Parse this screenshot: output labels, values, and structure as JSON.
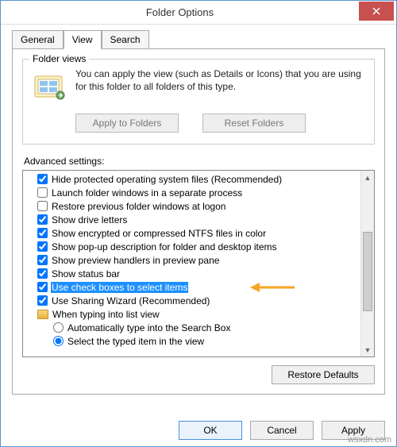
{
  "window": {
    "title": "Folder Options"
  },
  "tabs": {
    "general": "General",
    "view": "View",
    "search": "Search"
  },
  "folderViews": {
    "legend": "Folder views",
    "text": "You can apply the view (such as Details or Icons) that you are using for this folder to all folders of this type.",
    "applyBtn": "Apply to Folders",
    "resetBtn": "Reset Folders"
  },
  "advancedLabel": "Advanced settings:",
  "items": [
    {
      "type": "checkbox",
      "checked": true,
      "label": "Hide protected operating system files (Recommended)"
    },
    {
      "type": "checkbox",
      "checked": false,
      "label": "Launch folder windows in a separate process"
    },
    {
      "type": "checkbox",
      "checked": false,
      "label": "Restore previous folder windows at logon"
    },
    {
      "type": "checkbox",
      "checked": true,
      "label": "Show drive letters"
    },
    {
      "type": "checkbox",
      "checked": true,
      "label": "Show encrypted or compressed NTFS files in color"
    },
    {
      "type": "checkbox",
      "checked": true,
      "label": "Show pop-up description for folder and desktop items"
    },
    {
      "type": "checkbox",
      "checked": true,
      "label": "Show preview handlers in preview pane"
    },
    {
      "type": "checkbox",
      "checked": true,
      "label": "Show status bar"
    },
    {
      "type": "checkbox",
      "checked": true,
      "label": "Use check boxes to select items",
      "highlighted": true
    },
    {
      "type": "checkbox",
      "checked": true,
      "label": "Use Sharing Wizard (Recommended)"
    },
    {
      "type": "folder",
      "label": "When typing into list view"
    },
    {
      "type": "radio",
      "checked": false,
      "label": "Automatically type into the Search Box",
      "sub": true
    },
    {
      "type": "radio",
      "checked": true,
      "label": "Select the typed item in the view",
      "sub": true
    }
  ],
  "restoreDefaults": "Restore Defaults",
  "buttons": {
    "ok": "OK",
    "cancel": "Cancel",
    "apply": "Apply"
  },
  "watermark": "wsxdn.com"
}
